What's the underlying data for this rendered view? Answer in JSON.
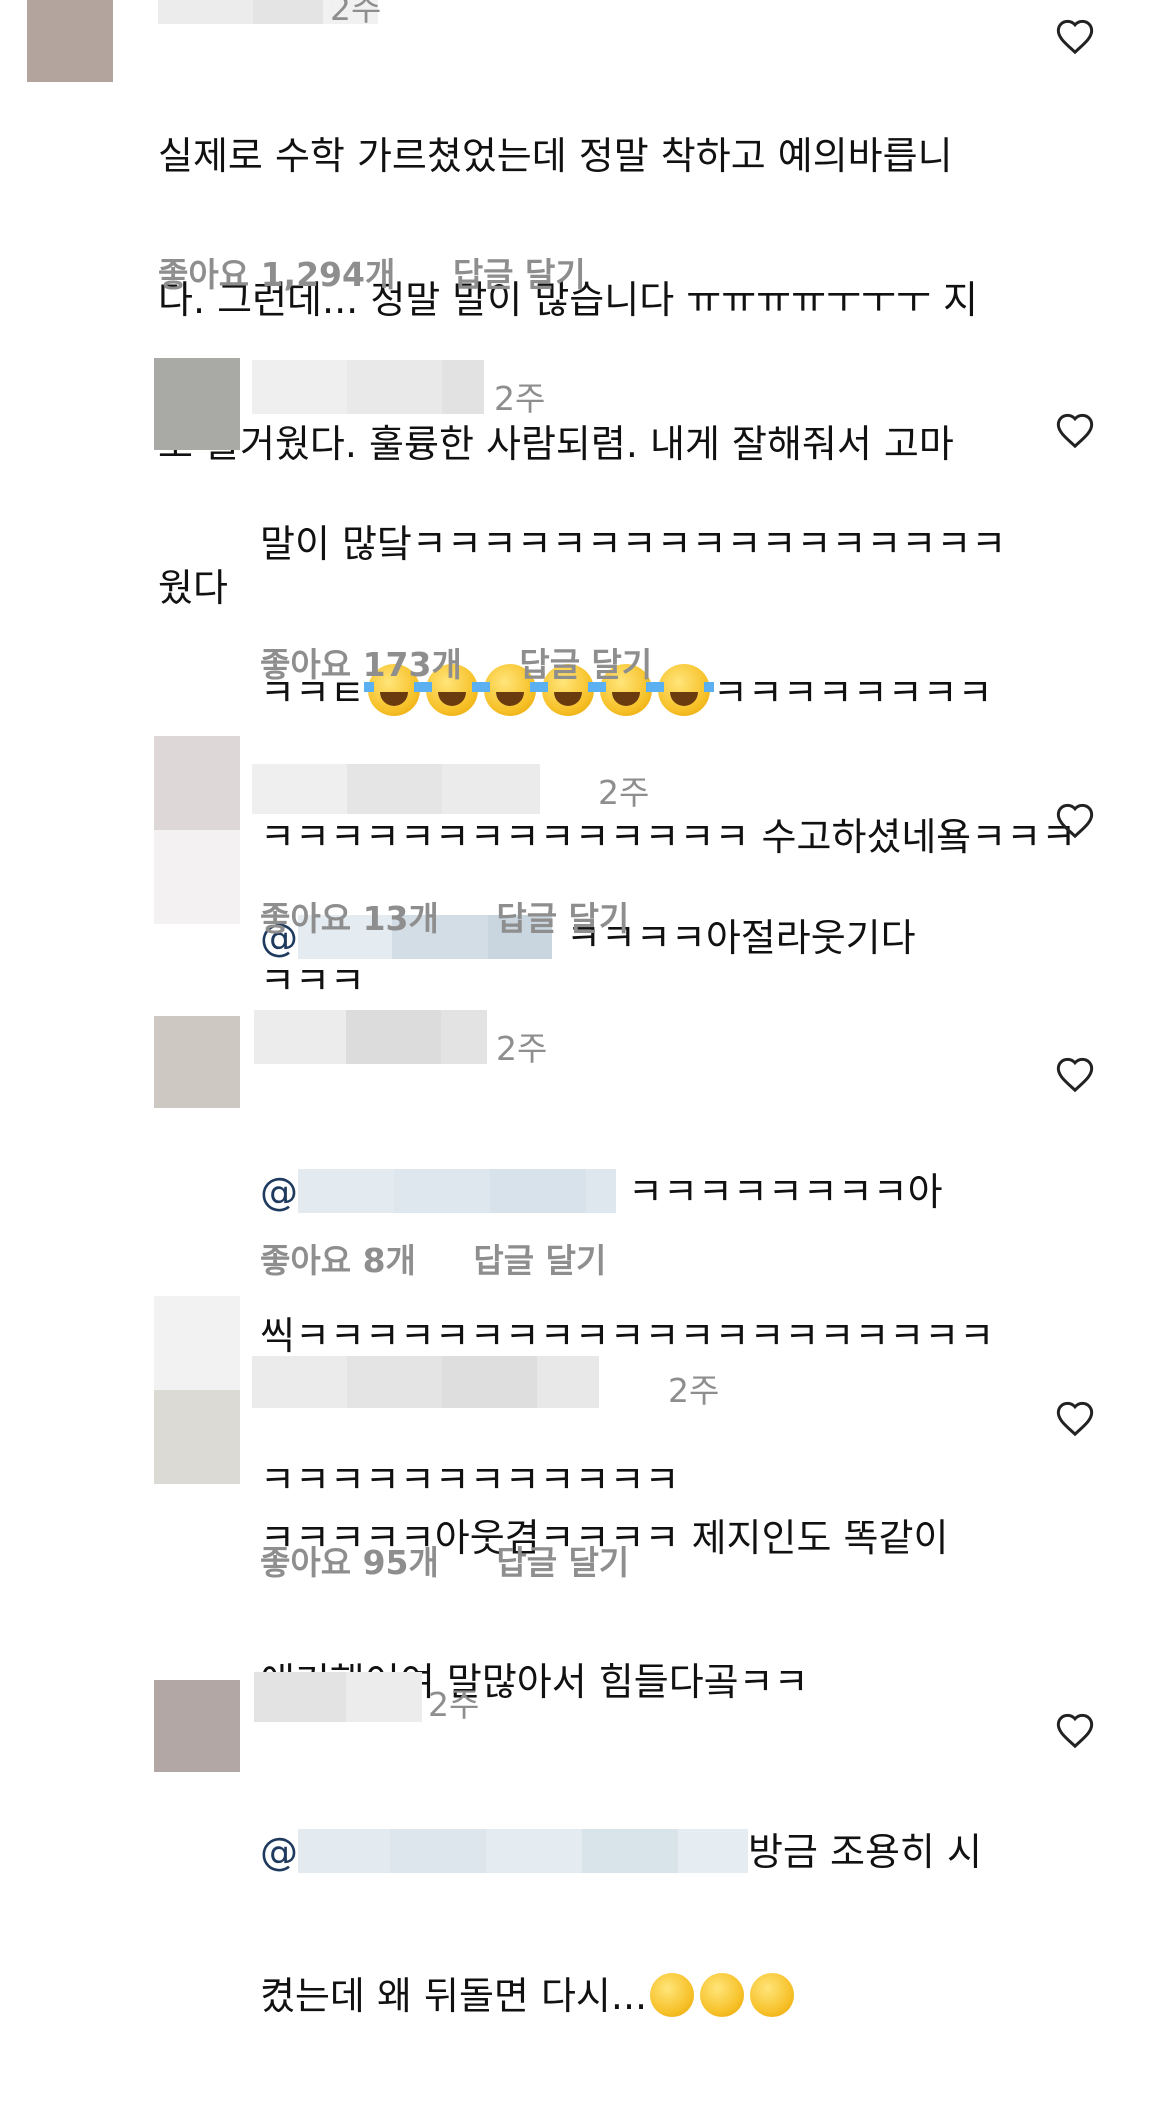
{
  "comments": [
    {
      "time": "2주",
      "lines": [
        "실제로 수학 가르쳤었는데 정말 착하고 예의바릅니",
        "다. 그런데... 정말 말이 많습니다 ㅠㅠㅠㅠㅜㅜㅜ 지",
        "호 즐거웠다. 훌륭한 사람되렴. 내게 잘해줘서 고마",
        "웠다"
      ],
      "likes": "좋아요 1,294개",
      "reply": "답글 달기"
    },
    {
      "time": "2주",
      "line1": "말이 많닼ㅋㅋㅋㅋㅋㅋㅋㅋㅋㅋㅋㅋㅋㅋㅋㅋㅋ",
      "line2_pre": "ㅋㅋㅌ",
      "line2_post": "ㅋㅋㅋㅋㅋㅋㅋㅋ",
      "line3": "ㅋㅋㅋㅋㅋㅋㅋㅋㅋㅋㅋㅋㅋㅋ 수고하셨네욬ㅋㅋㅋ",
      "line4": "ㅋㅋㅋ",
      "emoji": "face-with-tears-of-joy",
      "likes": "좋아요 173개",
      "reply": "답글 달기"
    },
    {
      "time": "2주",
      "at": "@",
      "text": "ㅋㅋㅋㅋ아절라웃기다",
      "likes": "좋아요 13개",
      "reply": "답글 달기"
    },
    {
      "time": "2주",
      "at": "@",
      "line1": "ㅋㅋㅋㅋㅋㅋㅋㅋ아",
      "line2": "씩ㅋㅋㅋㅋㅋㅋㅋㅋㅋㅋㅋㅋㅋㅋㅋㅋㅋㅋㅋㅋ",
      "line3": "ㅋㅋㅋㅋㅋㅋㅋㅋㅋㅋㅋㅋ",
      "likes": "좋아요 8개",
      "reply": "답글 달기"
    },
    {
      "time": "2주",
      "lines": [
        "ㅋㅋㅋㅋㅋ아웃겸ㅋㅋㅋㅋ 제지인도 똑같이",
        "얘기햇어여 말많아서 힘들다곸ㅋㅋ"
      ],
      "likes": "좋아요 95개",
      "reply": "답글 달기"
    },
    {
      "time": "2주",
      "at": "@",
      "line1": "방금 조용히 시",
      "line2": "켰는데 왜 뒤돌면 다시...",
      "emojis": [
        "sad-but-relieved-face",
        "pleading-face",
        "grinning-face-with-sweat"
      ]
    }
  ],
  "colors": {
    "meta_gray": "#8e8e8e",
    "text": "#111111",
    "mention": "#1f3a5f"
  },
  "icons": {
    "like": "heart-outline-icon"
  }
}
